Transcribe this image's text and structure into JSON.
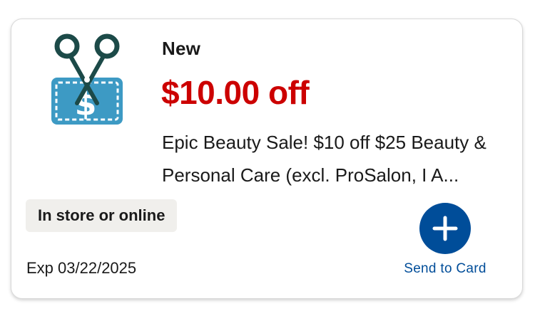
{
  "coupon": {
    "icon": "coupon-scissors-icon",
    "badge": "New",
    "amount": "$10.00 off",
    "description": "Epic Beauty Sale! $10 off $25 Beauty & Personal Care (excl. ProSalon, I A...",
    "channel": "In store or online",
    "expiry": "Exp 03/22/2025",
    "action": {
      "icon": "plus-icon",
      "label": "Send to Card"
    }
  },
  "colors": {
    "amount": "#cc0000",
    "action": "#004d99",
    "coupon_icon_body": "#3d9ac4",
    "coupon_icon_scissors": "#1c4a48",
    "pill_bg": "#f0efec"
  }
}
